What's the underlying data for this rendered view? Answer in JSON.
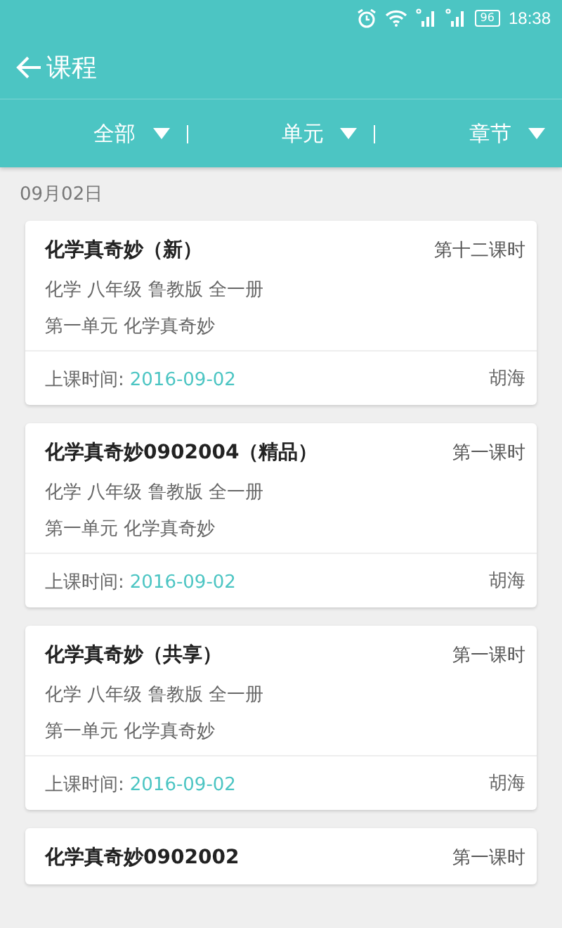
{
  "status_bar": {
    "battery": "96",
    "time": "18:38"
  },
  "header": {
    "title": "课程"
  },
  "filters": [
    {
      "label": "全部"
    },
    {
      "label": "单元"
    },
    {
      "label": "章节"
    }
  ],
  "date": "09月02日",
  "courses": [
    {
      "title": "化学真奇妙（新）",
      "lesson": "第十二课时",
      "book": "化学 八年级 鲁教版 全一册",
      "unit": "第一单元 化学真奇妙",
      "time_label": "上课时间:",
      "time": "2016-09-02",
      "teacher": "胡海"
    },
    {
      "title": "化学真奇妙0902004（精品）",
      "lesson": "第一课时",
      "book": "化学 八年级 鲁教版 全一册",
      "unit": "第一单元 化学真奇妙",
      "time_label": "上课时间:",
      "time": "2016-09-02",
      "teacher": "胡海"
    },
    {
      "title": "化学真奇妙（共享）",
      "lesson": "第一课时",
      "book": "化学 八年级 鲁教版 全一册",
      "unit": "第一单元 化学真奇妙",
      "time_label": "上课时间:",
      "time": "2016-09-02",
      "teacher": "胡海"
    },
    {
      "title": "化学真奇妙0902002",
      "lesson": "第一课时"
    }
  ]
}
